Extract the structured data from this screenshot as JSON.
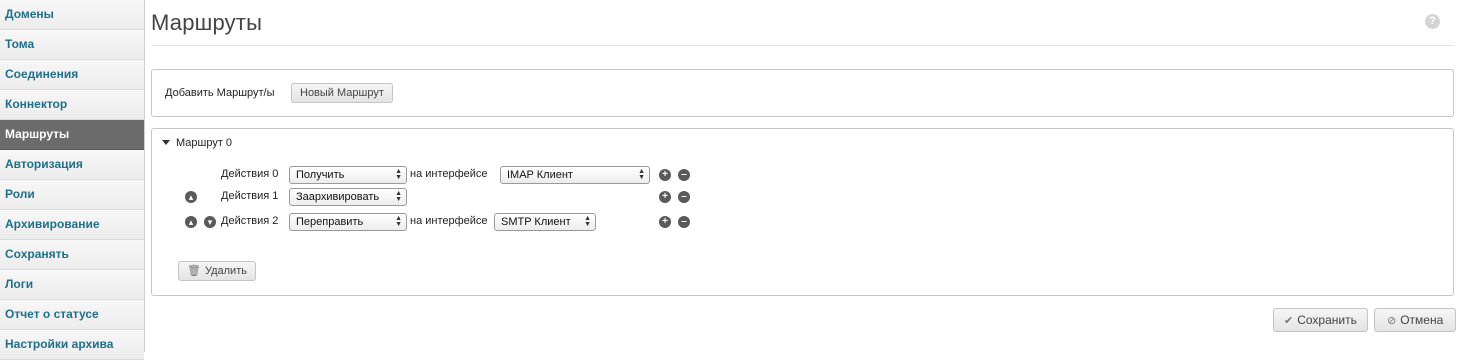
{
  "sidebar": {
    "items": [
      {
        "label": "Домены"
      },
      {
        "label": "Тома"
      },
      {
        "label": "Соединения"
      },
      {
        "label": "Коннектор"
      },
      {
        "label": "Маршруты",
        "active": true
      },
      {
        "label": "Авторизация"
      },
      {
        "label": "Роли"
      },
      {
        "label": "Архивирование"
      },
      {
        "label": "Сохранять"
      },
      {
        "label": "Логи"
      },
      {
        "label": "Отчет о статусе"
      },
      {
        "label": "Настройки архива"
      }
    ]
  },
  "page": {
    "title": "Маршруты",
    "help": "?"
  },
  "add_panel": {
    "label": "Добавить Маршрут/ы",
    "new_button": "Новый Маршрут"
  },
  "route": {
    "title": "Маршрут 0",
    "actions": [
      {
        "label": "Действия 0",
        "action": "Получить",
        "iface_label": "на интерфейсе",
        "iface": "IMAP Клиент"
      },
      {
        "label": "Действия 1",
        "action": "Заархивировать"
      },
      {
        "label": "Действия 2",
        "action": "Переправить",
        "iface_label": "на интерфейсе",
        "iface": "SMTP Клиент"
      }
    ],
    "delete_button": "Удалить"
  },
  "footer": {
    "save_button": "Сохранить",
    "cancel_button": "Отмена"
  },
  "colors": {
    "sidebar_link": "#1f6f8b",
    "sidebar_active_bg": "#6b6b6b"
  }
}
